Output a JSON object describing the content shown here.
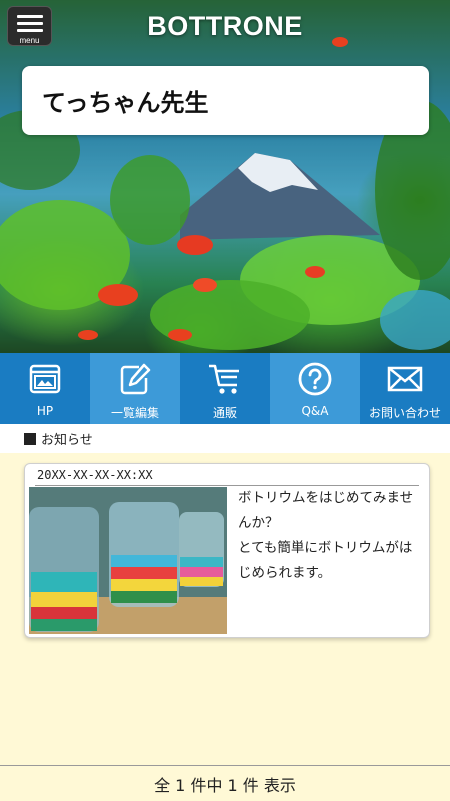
{
  "header": {
    "app_title": "BOTTRONE",
    "menu_label": "menu"
  },
  "profile": {
    "name": "てっちゃん先生"
  },
  "nav": {
    "items": [
      {
        "label": "HP",
        "icon": "website-icon"
      },
      {
        "label": "一覧編集",
        "icon": "edit-icon"
      },
      {
        "label": "通販",
        "icon": "cart-icon"
      },
      {
        "label": "Q&A",
        "icon": "question-icon"
      },
      {
        "label": "お問い合わせ",
        "icon": "mail-icon"
      }
    ]
  },
  "notice": {
    "section_title": "お知らせ",
    "items": [
      {
        "date": "20XX-XX-XX-XX:XX",
        "text": "ボトリウムをはじめてみませんか？\nとても簡単にボトリウムがはじめられます。",
        "image": "bottle-aquarium-photo"
      }
    ]
  },
  "footer": {
    "summary": "全 1 件中 1 件 表示"
  },
  "colors": {
    "nav_dark": "#1a7cc2",
    "nav_light": "#3d9ad8",
    "background": "#fff9d6"
  }
}
